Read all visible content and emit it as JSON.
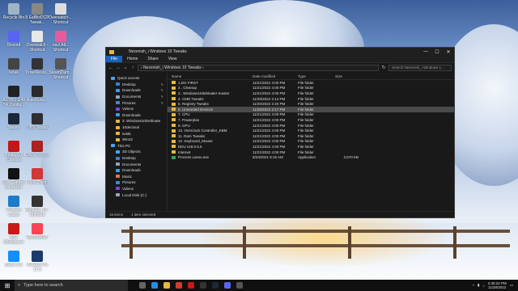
{
  "desktop": {
    "icons": [
      {
        "label": "Recycle Bin",
        "color": "#9fb4c7"
      },
      {
        "label": "Discord",
        "color": "#5865f2"
      },
      {
        "label": "Iwtak",
        "color": "#444444"
      },
      {
        "label": "ASTRO C40 TR Config...",
        "color": "#222222"
      },
      {
        "label": "Steam",
        "color": "#1b2838"
      },
      {
        "label": "Tobii's GX Capture",
        "color": "#c01818"
      },
      {
        "label": "Epic Games Launcher",
        "color": "#111111"
      },
      {
        "label": "Process Lasso",
        "color": "#1f7ac8"
      },
      {
        "label": "MSI Afterburner",
        "color": "#c81818"
      },
      {
        "label": "Battle.net",
        "color": "#148eff"
      }
    ],
    "icons_col2": [
      {
        "label": "8 EaBitxDCP Tweak...",
        "color": "#888888"
      },
      {
        "label": "Overwatch - Shortcut",
        "color": "#e8e8e8"
      },
      {
        "label": "TimerResol...",
        "color": "#333333"
      },
      {
        "label": "AutoRuns...",
        "color": "#2a2a2a"
      },
      {
        "label": "OBS Studio",
        "color": "#302e31"
      },
      {
        "label": "CAD_TR_Co...",
        "color": "#aa2222"
      },
      {
        "label": "Riot Client",
        "color": "#d13639"
      },
      {
        "label": "AsmLab_Tk - Shortcut",
        "color": "#333333"
      },
      {
        "label": "VALORANT",
        "color": "#fa4454"
      },
      {
        "label": "VEGAS Pro 17.0",
        "color": "#1a3b6b"
      }
    ],
    "icons_col3": [
      {
        "label": "Overwatch-... Shortcut",
        "color": "#ddd"
      },
      {
        "label": "osu! Alt... Shortcut",
        "color": "#e85a9c"
      },
      {
        "label": "SteamDum... Shortcut",
        "color": "#555"
      }
    ]
  },
  "window": {
    "title": "Nezenish_i Windows 10 Tweaks",
    "controls": {
      "minimize": "—",
      "maximize": "☐",
      "close": "✕"
    },
    "ribbon_tabs": [
      "File",
      "Home",
      "Share",
      "View"
    ],
    "address_path": "›  Nezenish_i Windows 10 Tweaks  ›",
    "search_placeholder": "Search Nezenish_i Windows 1...",
    "nav_pane": [
      {
        "label": "Quick access",
        "level": 0,
        "color": "#4aa3f0",
        "pinned": false
      },
      {
        "label": "Desktop",
        "level": 1,
        "color": "#3f7fd0",
        "pinned": true
      },
      {
        "label": "Downloads",
        "level": 1,
        "color": "#3aa0e0",
        "pinned": true
      },
      {
        "label": "Documents",
        "level": 1,
        "color": "#9aa5b5",
        "pinned": true
      },
      {
        "label": "Pictures",
        "level": 1,
        "color": "#3a8bd6",
        "pinned": true
      },
      {
        "label": "Videos",
        "level": 1,
        "color": "#7a4ad0",
        "pinned": false
      },
      {
        "label": "Downloads",
        "level": 1,
        "color": "#3aa0e0",
        "pinned": false
      },
      {
        "label": "3. Windows10Debloate",
        "level": 1,
        "color": "#e7b83f",
        "pinned": false
      },
      {
        "label": "10decimal",
        "level": 1,
        "color": "#e7b83f",
        "pinned": false
      },
      {
        "label": "Iwtak",
        "level": 1,
        "color": "#e7b83f",
        "pinned": false
      },
      {
        "label": "Win32",
        "level": 1,
        "color": "#e7b83f",
        "pinned": false
      },
      {
        "label": "This PC",
        "level": 0,
        "color": "#4aa3f0",
        "pinned": false
      },
      {
        "label": "3D Objects",
        "level": 1,
        "color": "#4aa3f0",
        "pinned": false
      },
      {
        "label": "Desktop",
        "level": 1,
        "color": "#3f7fd0",
        "pinned": false
      },
      {
        "label": "Documents",
        "level": 1,
        "color": "#9aa5b5",
        "pinned": false
      },
      {
        "label": "Downloads",
        "level": 1,
        "color": "#3aa0e0",
        "pinned": false
      },
      {
        "label": "Music",
        "level": 1,
        "color": "#e07a3a",
        "pinned": false
      },
      {
        "label": "Pictures",
        "level": 1,
        "color": "#3a8bd6",
        "pinned": false
      },
      {
        "label": "Videos",
        "level": 1,
        "color": "#7a4ad0",
        "pinned": false
      },
      {
        "label": "Local Disk (C:)",
        "level": 1,
        "color": "#9aa5b5",
        "pinned": false
      }
    ],
    "columns": [
      "Name",
      "Date modified",
      "Type",
      "Size"
    ],
    "files": [
      {
        "name": "1.DO FIRST",
        "date": "11/21/2022 4:00 PM",
        "type": "File folder",
        "size": "",
        "kind": "folder"
      },
      {
        "name": "2.. Cleanup",
        "date": "11/21/2022 4:00 PM",
        "type": "File folder",
        "size": "",
        "kind": "folder"
      },
      {
        "name": "3.. Windows10debloater-master",
        "date": "11/21/2022 4:00 PM",
        "type": "File folder",
        "size": "",
        "kind": "folder"
      },
      {
        "name": "4. CMD Tweaks",
        "date": "11/28/2022 2:14 PM",
        "type": "File folder",
        "size": "",
        "kind": "folder"
      },
      {
        "name": "5. Registry Tweaks",
        "date": "11/20/2022 2:20 PM",
        "type": "File folder",
        "size": "",
        "kind": "folder"
      },
      {
        "name": "6. Unneeded Devices",
        "date": "11/28/2022 2:17 PM",
        "type": "File folder",
        "size": "",
        "kind": "folder",
        "selected": true
      },
      {
        "name": "7. CPU",
        "date": "11/21/2022 4:00 PM",
        "type": "File folder",
        "size": "",
        "kind": "folder"
      },
      {
        "name": "7. Powerplan",
        "date": "11/21/2022 4:00 PM",
        "type": "File folder",
        "size": "",
        "kind": "folder"
      },
      {
        "name": "9. GPU",
        "date": "11/21/2022 4:00 PM",
        "type": "File folder",
        "size": "",
        "kind": "folder"
      },
      {
        "name": "10. Overclock Controller_KBM",
        "date": "11/21/2022 4:00 PM",
        "type": "File folder",
        "size": "",
        "kind": "folder"
      },
      {
        "name": "11. Ram Tweaks",
        "date": "11/21/2022 4:00 PM",
        "type": "File folder",
        "size": "",
        "kind": "folder"
      },
      {
        "name": "12. Keyboard_Mouse",
        "date": "11/21/2022 4:00 PM",
        "type": "File folder",
        "size": "",
        "kind": "folder"
      },
      {
        "name": "DDU v18.0.5.5",
        "date": "11/21/2022 4:00 PM",
        "type": "File folder",
        "size": "",
        "kind": "folder"
      },
      {
        "name": "Internet",
        "date": "11/21/2022 4:00 PM",
        "type": "File folder",
        "size": "",
        "kind": "folder"
      },
      {
        "name": "Process Lasso.exe",
        "date": "6/23/2021 8:15 AM",
        "type": "Application",
        "size": "3,570 KB",
        "kind": "app"
      }
    ],
    "status": {
      "items": "15 items",
      "selected": "1 item selected"
    }
  },
  "taskbar": {
    "search_placeholder": "Type here to search",
    "time": "2:36:24 PM",
    "date": "11/28/2022",
    "apps": [
      {
        "name": "task-view-icon",
        "color": "#666666"
      },
      {
        "name": "edge-icon",
        "color": "#1f8fe5"
      },
      {
        "name": "explorer-icon",
        "color": "#e7b83f"
      },
      {
        "name": "chrome-icon",
        "color": "#d33b2c"
      },
      {
        "name": "opera-icon",
        "color": "#c81818"
      },
      {
        "name": "terminal-icon",
        "color": "#333333"
      },
      {
        "name": "steam-icon",
        "color": "#1b2838"
      },
      {
        "name": "discord-icon",
        "color": "#5865f2"
      },
      {
        "name": "obs-icon",
        "color": "#555555"
      }
    ]
  }
}
